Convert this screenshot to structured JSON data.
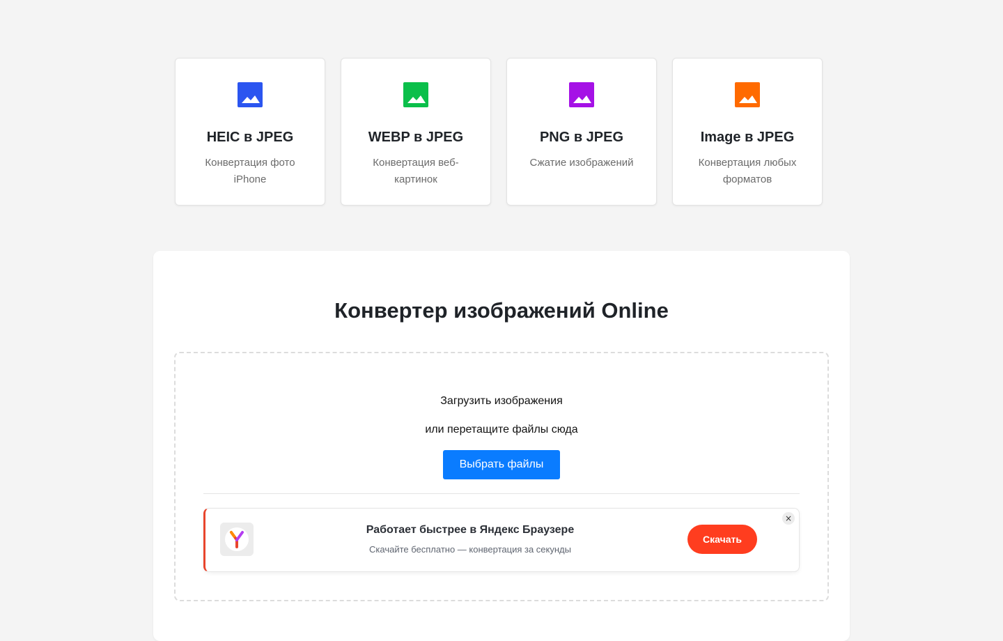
{
  "cards": [
    {
      "title": "HEIC в JPEG",
      "desc": "Конвертация фото iPhone",
      "icon": "image-icon",
      "color": "#2b55f0"
    },
    {
      "title": "WEBP в JPEG",
      "desc": "Конвертация веб-картинок",
      "icon": "image-icon",
      "color": "#0bbf4a"
    },
    {
      "title": "PNG в JPEG",
      "desc": "Сжатие изображений",
      "icon": "image-icon",
      "color": "#a511e6"
    },
    {
      "title": "Image в JPEG",
      "desc": "Конвертация любых форматов",
      "icon": "image-icon",
      "color": "#ff6a00"
    }
  ],
  "main": {
    "title": "Конвертер изображений Online"
  },
  "upload": {
    "title": "Загрузить изображения",
    "subtitle": "или перетащите файлы сюда",
    "button_label": "Выбрать файлы",
    "button_color": "#0a7cff"
  },
  "promo": {
    "title": "Работает быстрее в Яндекс Браузере",
    "subtitle": "Скачайте бесплатно — конвертация за секунды",
    "button_label": "Скачать",
    "close_symbol": "×",
    "logo_icon": "yandex-browser-logo",
    "accent_color": "#ff3d1f"
  }
}
